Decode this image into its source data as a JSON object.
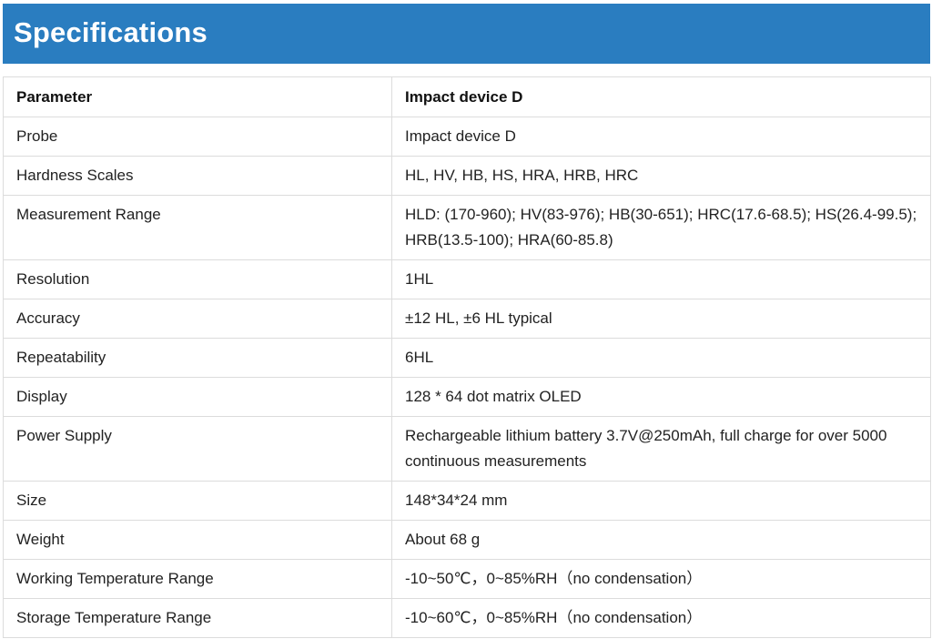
{
  "header": {
    "title": "Specifications"
  },
  "table": {
    "columns": [
      "Parameter",
      "Impact device D"
    ],
    "rows": [
      {
        "parameter": "Probe",
        "value": "Impact device D"
      },
      {
        "parameter": "Hardness Scales",
        "value": "HL, HV, HB, HS, HRA, HRB, HRC"
      },
      {
        "parameter": "Measurement Range",
        "value": "HLD: (170-960); HV(83-976); HB(30-651); HRC(17.6-68.5); HS(26.4-99.5); HRB(13.5-100); HRA(60-85.8)"
      },
      {
        "parameter": "Resolution",
        "value": "1HL"
      },
      {
        "parameter": "Accuracy",
        "value": "±12 HL, ±6 HL typical"
      },
      {
        "parameter": "Repeatability",
        "value": "6HL"
      },
      {
        "parameter": "Display",
        "value": "128 * 64 dot matrix OLED"
      },
      {
        "parameter": "Power Supply",
        "value": "Rechargeable lithium battery 3.7V@250mAh, full charge for over 5000 continuous measurements"
      },
      {
        "parameter": "Size",
        "value": "148*34*24 mm"
      },
      {
        "parameter": "Weight",
        "value": "About 68 g"
      },
      {
        "parameter": "Working Temperature Range",
        "value": "-10~50℃，0~85%RH（no condensation）"
      },
      {
        "parameter": "Storage Temperature Range",
        "value": "-10~60℃，0~85%RH（no condensation）"
      }
    ]
  },
  "colors": {
    "banner_background": "#2a7dc0",
    "banner_text": "#ffffff",
    "table_border": "#dcdcdc",
    "text": "#222222"
  }
}
